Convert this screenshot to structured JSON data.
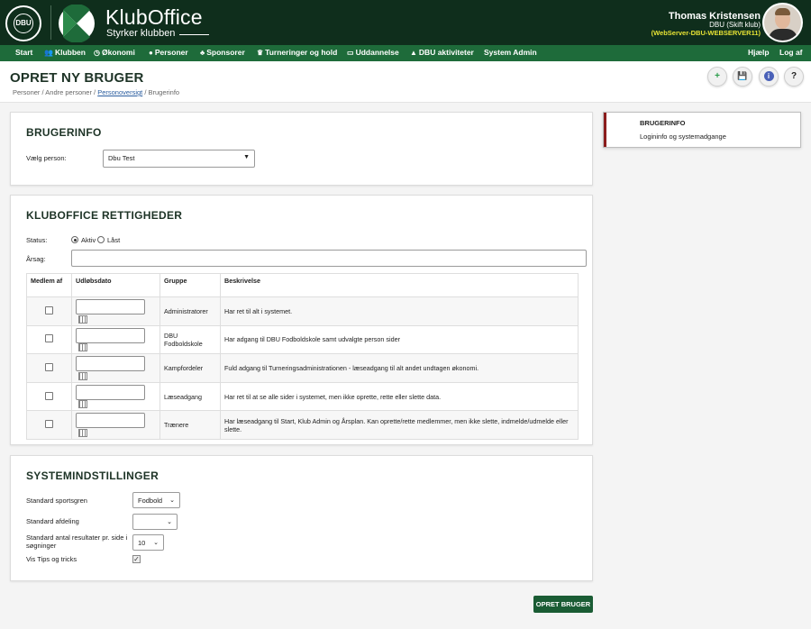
{
  "header": {
    "dbu_logo_text": "DBU",
    "dbu_ring_text": "DANSK BOLDSPIL UNION 1889",
    "brand_title": "KlubOffice",
    "brand_subtitle": "Styrker klubben",
    "user_name": "Thomas Kristensen",
    "user_club": "DBU (Skift klub)",
    "server": "(WebServer-DBU-WEBSERVER11)"
  },
  "nav": {
    "items": [
      {
        "label": "Start",
        "icon": ""
      },
      {
        "label": "Klubben",
        "icon": "people-icon"
      },
      {
        "label": "Økonomi",
        "icon": "coin-icon"
      },
      {
        "label": "Personer",
        "icon": "person-icon"
      },
      {
        "label": "Sponsorer",
        "icon": "sponsor-icon"
      },
      {
        "label": "Turneringer og hold",
        "icon": "trophy-icon"
      },
      {
        "label": "Uddannelse",
        "icon": "board-icon"
      },
      {
        "label": "DBU aktiviteter",
        "icon": "graduation-icon"
      },
      {
        "label": "System Admin",
        "icon": ""
      }
    ],
    "help": "Hjælp",
    "logout": "Log af"
  },
  "page": {
    "title": "OPRET NY BRUGER",
    "breadcrumb": {
      "part1": "Personer / Andre personer / ",
      "link": "Personoversigt",
      "part2": " / Brugerinfo"
    }
  },
  "toolbar": {
    "add": "+",
    "save": "💾",
    "info": "i",
    "help": "?"
  },
  "brugerinfo": {
    "title": "BRUGERINFO",
    "person_label": "Vælg person:",
    "person_value": "Dbu Test"
  },
  "rettigheder": {
    "title": "KLUBOFFICE RETTIGHEDER",
    "status_label": "Status:",
    "status_options": [
      "Aktiv",
      "Låst"
    ],
    "status_selected": "Aktiv",
    "reason_label": "Årsag:",
    "columns": [
      "Medlem af",
      "Udløbsdato",
      "Gruppe",
      "Beskrivelse"
    ],
    "rows": [
      {
        "group": "Administratorer",
        "desc": "Har ret til alt i systemet."
      },
      {
        "group": "DBU Fodboldskole",
        "desc": "Har adgang til DBU Fodboldskole samt udvalgte person sider"
      },
      {
        "group": "Kampfordeler",
        "desc": "Fuld adgang til Turneringsadministrationen - læseadgang til alt andet undtagen økonomi."
      },
      {
        "group": "Læseadgang",
        "desc": "Har ret til at se alle sider i systemet, men ikke oprette, rette eller slette data."
      },
      {
        "group": "Trænere",
        "desc": "Har læseadgang til Start, Klub Admin og Årsplan. Kan oprette/rette medlemmer, men ikke slette, indmelde/udmelde eller slette."
      }
    ]
  },
  "system": {
    "title": "SYSTEMINDSTILLINGER",
    "sport_label": "Standard sportsgren",
    "sport_value": "Fodbold",
    "dept_label": "Standard afdeling",
    "dept_value": "",
    "results_label": "Standard antal resultater pr. side i søgninger",
    "results_value": "10",
    "tips_label": "Vis Tips og tricks",
    "tips_checked": true
  },
  "side": {
    "title": "BRUGERINFO",
    "subtitle": "Logininfo og systemadgange"
  },
  "submit_label": "OPRET BRUGER",
  "colors": {
    "header_bg": "#0f2e1c",
    "nav_bg": "#1e6b3a",
    "accent_red": "#8b1c1c",
    "server_yellow": "#e5e234",
    "primary_button": "#1a5c34"
  }
}
